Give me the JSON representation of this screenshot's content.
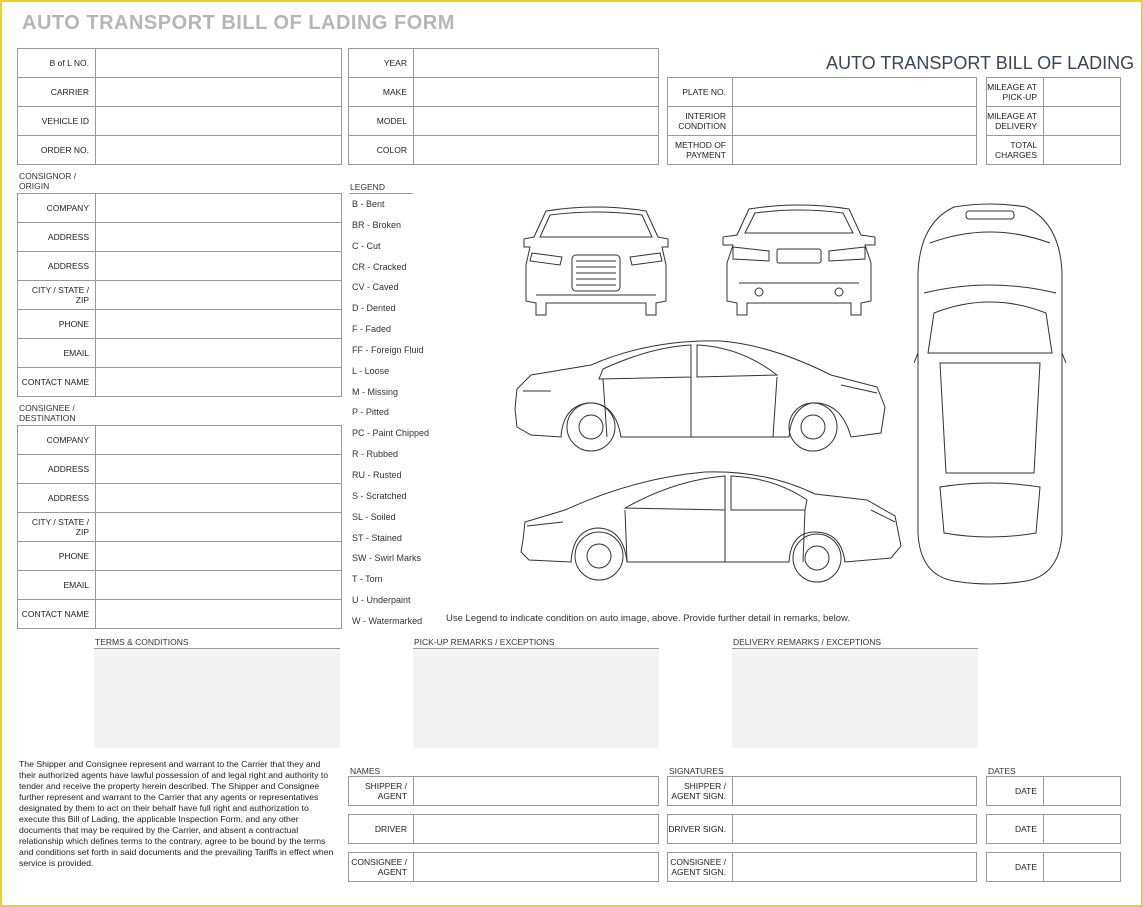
{
  "title": "AUTO TRANSPORT BILL OF LADING FORM",
  "subtitle": "AUTO TRANSPORT BILL OF LADING",
  "order_info": [
    "B of L NO.",
    "CARRIER",
    "VEHICLE ID",
    "ORDER NO."
  ],
  "vehicle_info": [
    "YEAR",
    "MAKE",
    "MODEL",
    "COLOR"
  ],
  "condition_info": [
    "PLATE NO.",
    "INTERIOR CONDITION",
    "METHOD OF PAYMENT"
  ],
  "mileage_info": [
    "MILEAGE AT PICK-UP",
    "MILEAGE AT DELIVERY",
    "TOTAL CHARGES"
  ],
  "consignor": {
    "heading": "CONSIGNOR / ORIGIN",
    "fields": [
      "COMPANY",
      "ADDRESS",
      "ADDRESS",
      "CITY / STATE / ZIP",
      "PHONE",
      "EMAIL",
      "CONTACT NAME"
    ]
  },
  "consignee": {
    "heading": "CONSIGNEE / DESTINATION",
    "fields": [
      "COMPANY",
      "ADDRESS",
      "ADDRESS",
      "CITY / STATE / ZIP",
      "PHONE",
      "EMAIL",
      "CONTACT NAME"
    ]
  },
  "legend": {
    "heading": "LEGEND",
    "items": [
      "B - Bent",
      "BR - Broken",
      "C - Cut",
      "CR - Cracked",
      "CV - Caved",
      "D - Dented",
      "F - Faded",
      "FF - Foreign Fluid",
      "L - Loose",
      "M - Missing",
      "P - Pitted",
      "PC - Paint Chipped",
      "R - Rubbed",
      "RU - Rusted",
      "S - Scratched",
      "SL - Soiled",
      "ST - Stained",
      "SW - Swirl Marks",
      "T - Torn",
      "U - Underpaint",
      "W - Watermarked"
    ],
    "note": "Use Legend to indicate condition on auto image, above.  Provide further detail in remarks, below."
  },
  "remarks": {
    "terms": "TERMS & CONDITIONS",
    "pickup": "PICK-UP REMARKS / EXCEPTIONS",
    "delivery": "DELIVERY REMARKS / EXCEPTIONS"
  },
  "warranty_text": "The Shipper and Consignee represent and warrant to the Carrier that they and their authorized agents have lawful possession of and legal right and authority to tender and receive the property herein described. The Shipper and Consignee further represent and warrant to the Carrier that any agents or representatives designated by them to act on their behalf have full right and authorization to execute this Bill of Lading, the applicable Inspection Form, and any other documents that may be required by the Carrier, and absent a contractual relationship which defines terms to the contrary, agree to be bound by the terms and conditions set forth in said documents and the prevailing Tariffs in effect when service is provided.",
  "names": {
    "heading": "NAMES",
    "rows": [
      "SHIPPER / AGENT",
      "DRIVER",
      "CONSIGNEE / AGENT"
    ]
  },
  "signatures": {
    "heading": "SIGNATURES",
    "rows": [
      "SHIPPER / AGENT SIGN.",
      "DRIVER SIGN.",
      "CONSIGNEE / AGENT SIGN."
    ]
  },
  "dates": {
    "heading": "DATES",
    "rows": [
      "DATE",
      "DATE",
      "DATE"
    ]
  },
  "colors": {
    "border_frame": "#e6cf3a",
    "title_gray": "#b6b6b6",
    "subtitle_navy": "#3a4556",
    "remark_fill": "#f3f3f3"
  },
  "icons": [
    "car-front-view-icon",
    "car-rear-view-icon",
    "car-left-side-icon",
    "car-right-side-icon",
    "car-top-view-icon"
  ]
}
